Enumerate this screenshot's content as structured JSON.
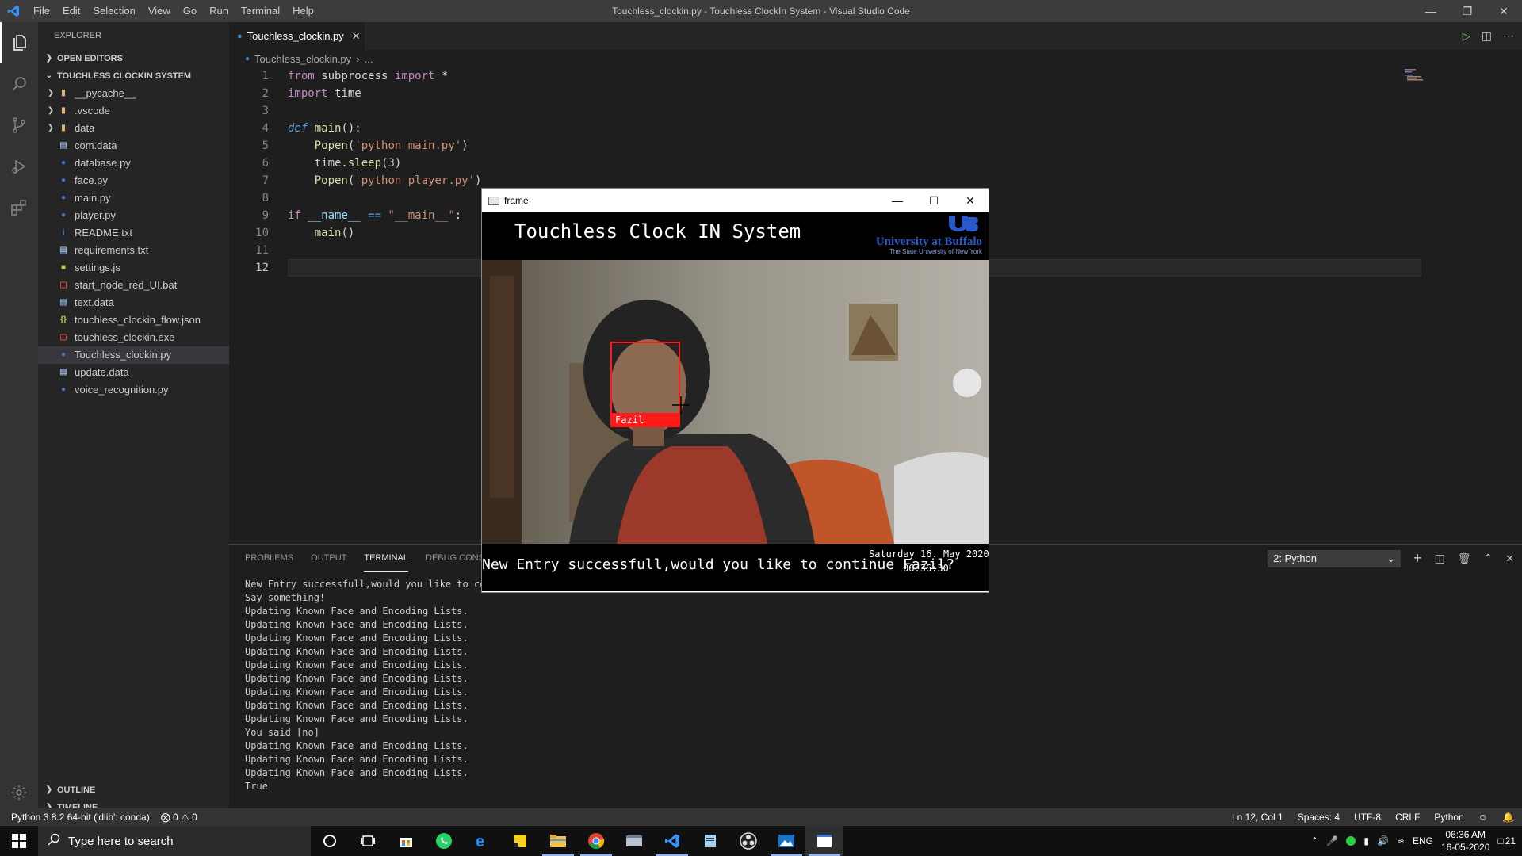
{
  "window": {
    "title": "Touchless_clockin.py - Touchless ClockIn System - Visual Studio Code",
    "menu": [
      "File",
      "Edit",
      "Selection",
      "View",
      "Go",
      "Run",
      "Terminal",
      "Help"
    ]
  },
  "sidebar": {
    "title": "EXPLORER",
    "open_editors": "OPEN EDITORS",
    "project": "TOUCHLESS CLOCKIN SYSTEM",
    "items": [
      {
        "label": "__pycache__",
        "kind": "folder"
      },
      {
        "label": ".vscode",
        "kind": "folder"
      },
      {
        "label": "data",
        "kind": "folder"
      },
      {
        "label": "com.data",
        "kind": "file"
      },
      {
        "label": "database.py",
        "kind": "python"
      },
      {
        "label": "face.py",
        "kind": "python"
      },
      {
        "label": "main.py",
        "kind": "python"
      },
      {
        "label": "player.py",
        "kind": "python"
      },
      {
        "label": "README.txt",
        "kind": "info"
      },
      {
        "label": "requirements.txt",
        "kind": "file"
      },
      {
        "label": "settings.js",
        "kind": "js"
      },
      {
        "label": "start_node_red_UI.bat",
        "kind": "bat"
      },
      {
        "label": "text.data",
        "kind": "file"
      },
      {
        "label": "touchless_clockin_flow.json",
        "kind": "json"
      },
      {
        "label": "touchless_clockin.exe",
        "kind": "exe"
      },
      {
        "label": "Touchless_clockin.py",
        "kind": "python",
        "selected": true
      },
      {
        "label": "update.data",
        "kind": "file"
      },
      {
        "label": "voice_recognition.py",
        "kind": "python"
      }
    ],
    "outline": "OUTLINE",
    "timeline": "TIMELINE"
  },
  "editor": {
    "tab_label": "Touchless_clockin.py",
    "breadcrumb_file": "Touchless_clockin.py",
    "breadcrumb_more": "...",
    "line_numbers": [
      "1",
      "2",
      "3",
      "4",
      "5",
      "6",
      "7",
      "8",
      "9",
      "10",
      "11",
      "12"
    ]
  },
  "panel": {
    "tabs": [
      "PROBLEMS",
      "OUTPUT",
      "TERMINAL",
      "DEBUG CONSOLE"
    ],
    "active_tab": "TERMINAL",
    "terminal_select": "2: Python",
    "lines": [
      "New Entry successfull,would you like to cor",
      "Say something!",
      "Updating Known Face and Encoding Lists.",
      "Updating Known Face and Encoding Lists.",
      "Updating Known Face and Encoding Lists.",
      "Updating Known Face and Encoding Lists.",
      "Updating Known Face and Encoding Lists.",
      "Updating Known Face and Encoding Lists.",
      "Updating Known Face and Encoding Lists.",
      "Updating Known Face and Encoding Lists.",
      "Updating Known Face and Encoding Lists.",
      "You said [no]",
      "Updating Known Face and Encoding Lists.",
      "Updating Known Face and Encoding Lists.",
      "Updating Known Face and Encoding Lists.",
      "True"
    ]
  },
  "statusbar": {
    "interpreter": "Python 3.8.2 64-bit ('dlib': conda)",
    "errors": "0",
    "warnings": "0",
    "position": "Ln 12, Col 1",
    "spaces": "Spaces: 4",
    "encoding": "UTF-8",
    "eol": "CRLF",
    "language": "Python"
  },
  "frame": {
    "window_title": "frame",
    "header_title": "Touchless Clock IN System",
    "ub_name": "University at Buffalo",
    "ub_sub": "The State University of New York",
    "face_label": "Fazil",
    "message": "New Entry successfull,would you like to continue Fazil?",
    "date": "Saturday 16. May 2020",
    "time": "06:36:30"
  },
  "taskbar": {
    "search_placeholder": "Type here to search",
    "lang": "ENG",
    "time": "06:36 AM",
    "date": "16-05-2020",
    "notifications": "21"
  },
  "colors": {
    "accent": "#007acc",
    "face_box": "#ff1a1a",
    "ub_blue": "#2a5ac9"
  }
}
